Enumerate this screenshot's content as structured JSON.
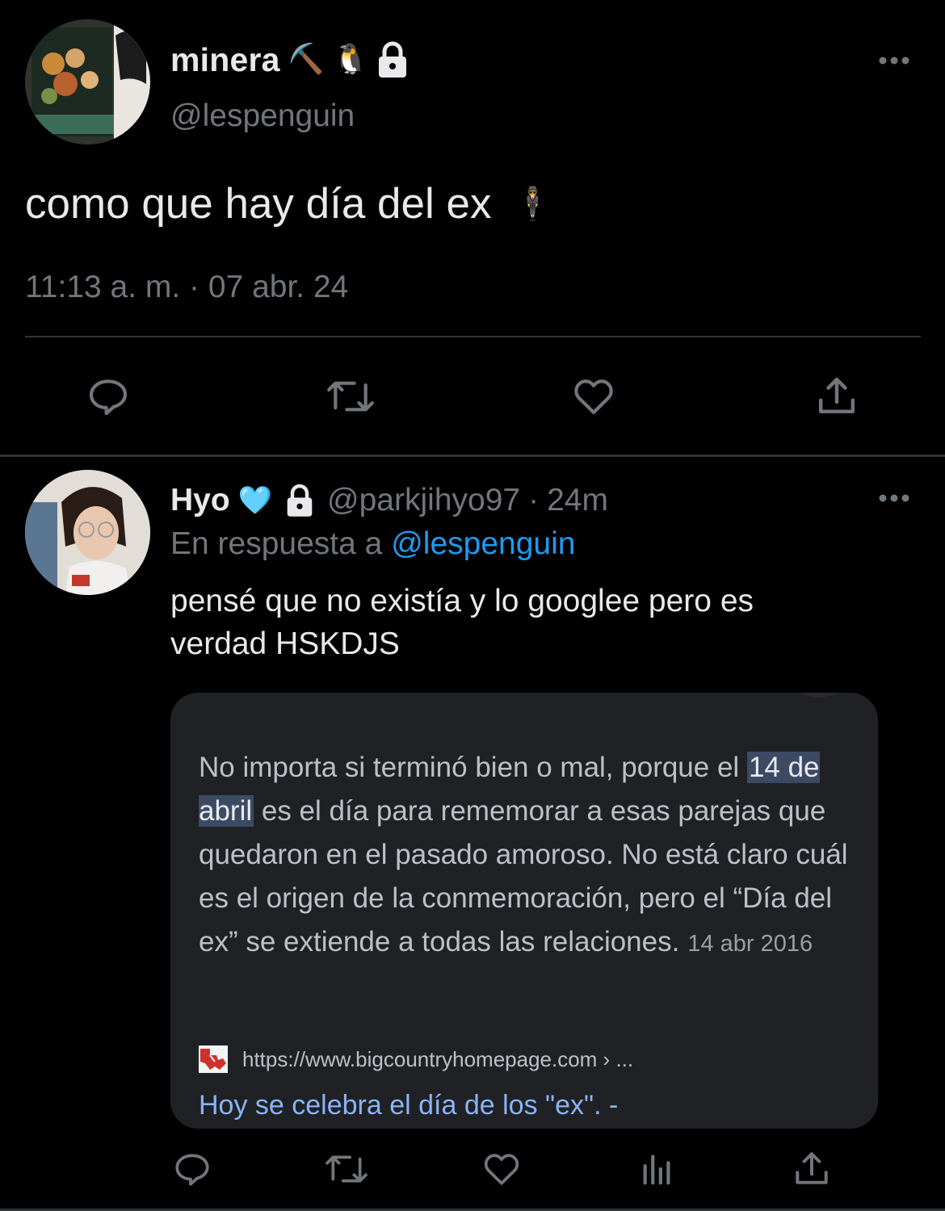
{
  "main_tweet": {
    "display_name": "minera",
    "name_emojis": [
      "⛏️",
      "🐧"
    ],
    "handle": "@lespenguin",
    "text": "como que hay día del ex",
    "text_emoji": "🕴️",
    "timestamp": "11:13 a. m. · 07 abr. 24",
    "actions": [
      "reply-icon",
      "retweet-icon",
      "like-icon",
      "share-icon"
    ]
  },
  "reply": {
    "display_name": "Hyo",
    "name_emoji": "🩵",
    "handle": "@parkjihyo97",
    "time_sep": "·",
    "time": "24m",
    "replying_prefix": "En respuesta a",
    "replying_to": "@lespenguin",
    "text_line1": "pensé que no existía y lo googlee pero es",
    "text_line2": "verdad HSKDJS",
    "actions": [
      "reply-icon",
      "retweet-icon",
      "like-icon",
      "views-icon",
      "share-icon"
    ]
  },
  "embedded_result": {
    "before_highlight": "No importa si terminó bien o mal, porque el ",
    "highlight": "14 de abril",
    "after_highlight": " es el día para rememorar a esas parejas que quedaron en el pasado amoroso. No está claro cuál es el origen de la conmemoración, pero el “Día del ex” se extiende a todas las relaciones.",
    "date": "14 abr 2016",
    "source_url": "https://www.bigcountryhomepage.com › ...",
    "result_title": "Hoy se celebra el día de los \"ex\". -"
  },
  "colors": {
    "background": "#000000",
    "text_primary": "#e7e9ea",
    "text_secondary": "#71767b",
    "link": "#1d9bf0",
    "card_background": "#202124",
    "result_link": "#8ab4f8"
  }
}
